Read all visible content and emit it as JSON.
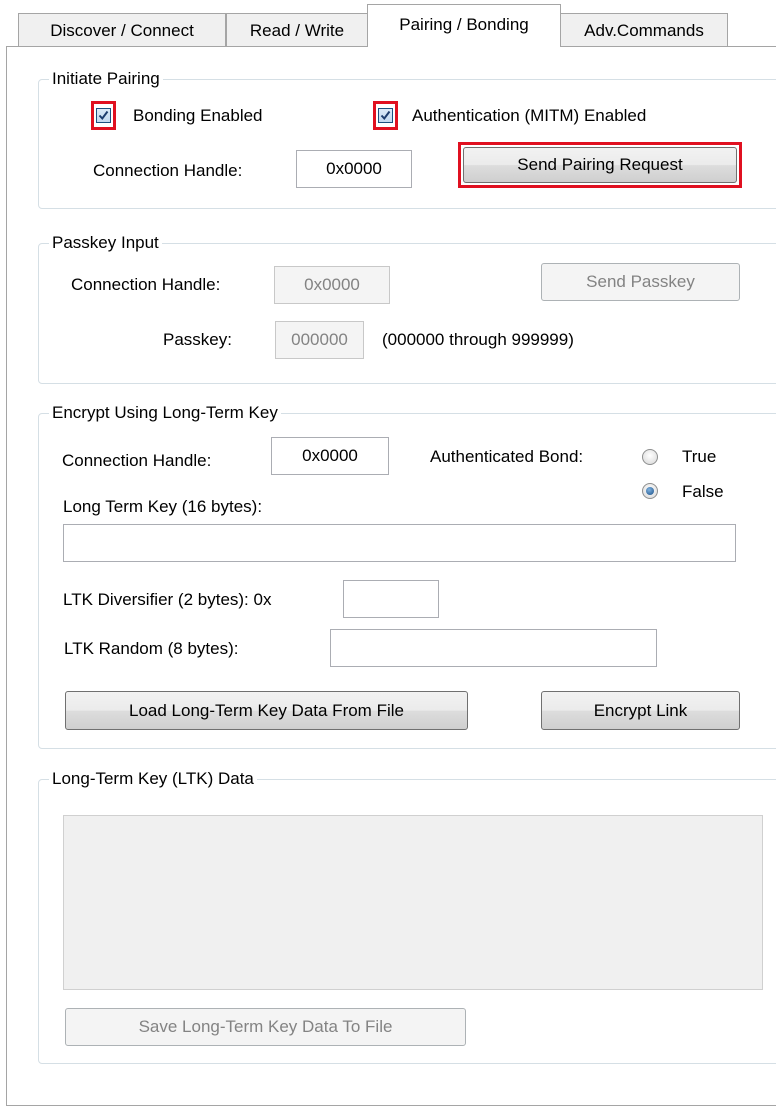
{
  "tabs": [
    {
      "label": "Discover / Connect"
    },
    {
      "label": "Read / Write"
    },
    {
      "label": "Pairing / Bonding",
      "active": true
    },
    {
      "label": "Adv.Commands"
    }
  ],
  "initiate_pairing": {
    "title": "Initiate Pairing",
    "bonding_label": "Bonding Enabled",
    "bonding_checked": true,
    "auth_label": "Authentication (MITM) Enabled",
    "auth_checked": true,
    "handle_label": "Connection Handle:",
    "handle_value": "0x0000",
    "send_button": "Send Pairing Request"
  },
  "passkey_input": {
    "title": "Passkey Input",
    "handle_label": "Connection Handle:",
    "handle_value": "0x0000",
    "send_button": "Send Passkey",
    "passkey_label": "Passkey:",
    "passkey_value": "000000",
    "range_hint": "(000000 through 999999)"
  },
  "encrypt": {
    "title": "Encrypt Using Long-Term Key",
    "handle_label": "Connection Handle:",
    "handle_value": "0x0000",
    "auth_bond_label": "Authenticated Bond:",
    "true_label": "True",
    "false_label": "False",
    "selected": "False",
    "ltk_label": "Long Term Key (16 bytes):",
    "ltk_value": "",
    "diversifier_label": "LTK Diversifier (2 bytes): 0x",
    "diversifier_value": "",
    "random_label": "LTK Random (8 bytes):",
    "random_value": "",
    "load_button": "Load Long-Term Key Data From File",
    "encrypt_button": "Encrypt Link"
  },
  "ltk_data": {
    "title": "Long-Term Key (LTK) Data",
    "save_button": "Save Long-Term Key Data To File"
  },
  "colors": {
    "highlight": "#e01020",
    "group_border": "#d5dfe5"
  }
}
